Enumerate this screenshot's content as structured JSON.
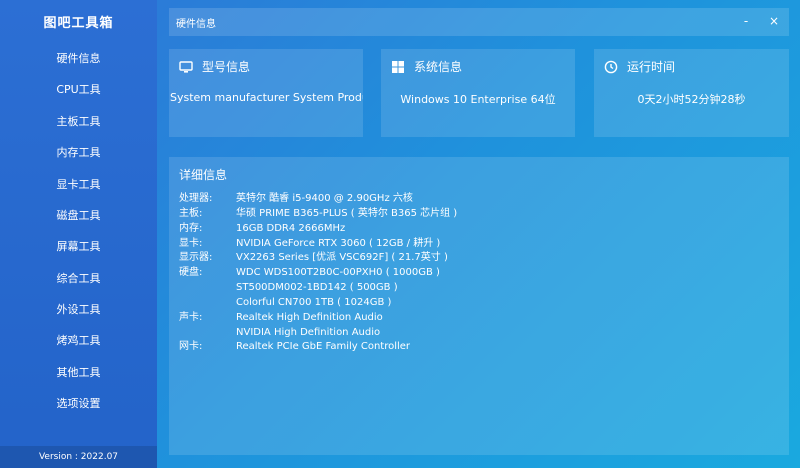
{
  "app": {
    "title": "图吧工具箱",
    "version": "Version : 2022.07"
  },
  "sidebar": {
    "items": [
      {
        "label": "硬件信息",
        "id": "hardware-info"
      },
      {
        "label": "CPU工具",
        "id": "cpu-tools"
      },
      {
        "label": "主板工具",
        "id": "motherboard-tools"
      },
      {
        "label": "内存工具",
        "id": "memory-tools"
      },
      {
        "label": "显卡工具",
        "id": "gpu-tools"
      },
      {
        "label": "磁盘工具",
        "id": "disk-tools"
      },
      {
        "label": "屏幕工具",
        "id": "screen-tools"
      },
      {
        "label": "综合工具",
        "id": "general-tools"
      },
      {
        "label": "外设工具",
        "id": "peripheral-tools"
      },
      {
        "label": "烤鸡工具",
        "id": "stress-tools"
      },
      {
        "label": "其他工具",
        "id": "other-tools"
      },
      {
        "label": "选项设置",
        "id": "settings"
      }
    ]
  },
  "window": {
    "title": "硬件信息",
    "minimize": "-",
    "close": "×"
  },
  "cards": {
    "model": {
      "title": "型号信息",
      "value": "System manufacturer System Product Name",
      "icon": "monitor-icon"
    },
    "system": {
      "title": "系统信息",
      "value": "Windows 10 Enterprise 64位",
      "icon": "windows-icon"
    },
    "uptime": {
      "title": "运行时间",
      "value": "0天2小时52分钟28秒",
      "icon": "clock-icon"
    }
  },
  "details": {
    "title": "详细信息",
    "rows": [
      {
        "label": "处理器:",
        "value": "英特尔 酷睿 i5-9400 @ 2.90GHz 六核"
      },
      {
        "label": "主板:",
        "value": "华硕 PRIME B365-PLUS ( 英特尔 B365 芯片组 )"
      },
      {
        "label": "内存:",
        "value": "16GB DDR4 2666MHz"
      },
      {
        "label": "显卡:",
        "value": "NVIDIA GeForce RTX 3060 ( 12GB / 耕升 )"
      },
      {
        "label": "显示器:",
        "value": "VX2263 Series [优派 VSC692F] ( 21.7英寸 )"
      },
      {
        "label": "硬盘:",
        "value": "WDC WDS100T2B0C-00PXH0 ( 1000GB )"
      },
      {
        "label": "",
        "value": "ST500DM002-1BD142 ( 500GB )"
      },
      {
        "label": "",
        "value": "Colorful CN700 1TB ( 1024GB )"
      },
      {
        "label": "声卡:",
        "value": "Realtek High Definition Audio"
      },
      {
        "label": "",
        "value": "NVIDIA High Definition Audio"
      },
      {
        "label": "网卡:",
        "value": "Realtek PCIe GbE Family Controller"
      }
    ]
  },
  "colors": {
    "sidebar": "#2c6fd4",
    "background": "#1f92dc",
    "text": "#ffffff"
  }
}
